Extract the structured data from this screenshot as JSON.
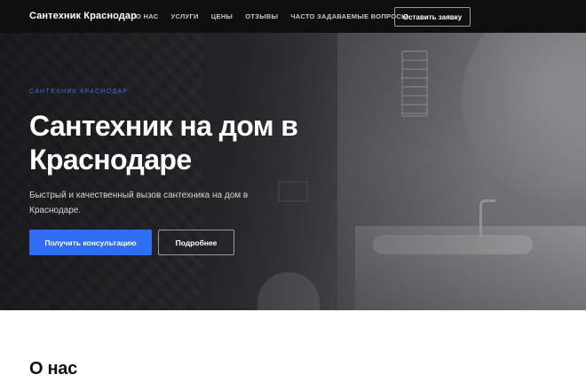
{
  "header": {
    "brand": "Сантехник Краснодар",
    "nav": [
      {
        "label": "О НАС"
      },
      {
        "label": "УСЛУГИ"
      },
      {
        "label": "ЦЕНЫ"
      },
      {
        "label": "ОТЗЫВЫ"
      },
      {
        "label": "ЧАСТО ЗАДАВАЕМЫЕ ВОПРОСЫ"
      }
    ],
    "cta_label": "Оставить заявку"
  },
  "hero": {
    "eyebrow": "САНТЕХНИК КРАСНОДАР",
    "title": "Сантехник на дом в Краснодаре",
    "subtitle": "Быстрый и качественный вызов сантехника на дом в Краснодаре.",
    "primary_button": "Получить консультацию",
    "secondary_button": "Подробнее"
  },
  "about": {
    "title": "О нас"
  },
  "colors": {
    "accent": "#2f6df2",
    "header_bg": "#0f0f10"
  }
}
